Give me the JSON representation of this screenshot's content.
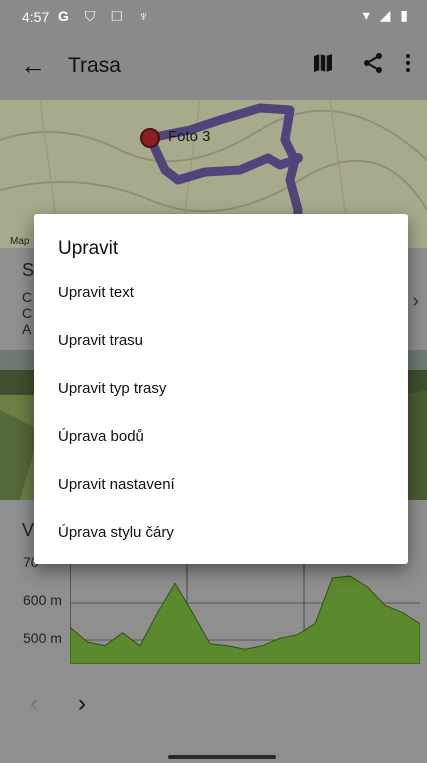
{
  "status_bar": {
    "time": "4:57",
    "icons": [
      "google-g-icon",
      "shield-icon",
      "screenshot-icon",
      "usb-icon"
    ],
    "right_icons": [
      "wifi-icon",
      "signal-icon",
      "battery-icon"
    ]
  },
  "app_bar": {
    "title": "Trasa",
    "back_icon": "arrow-back-icon",
    "actions": [
      "map-icon",
      "share-icon",
      "more-vert-icon"
    ]
  },
  "map": {
    "marker_label": "Foto 3",
    "attribution": "Map"
  },
  "background": {
    "section_letter": "S",
    "line1": "C",
    "line2": "C",
    "line3": "A",
    "chart_section_letter": "V"
  },
  "chart_data": {
    "type": "area",
    "y_ticks": [
      "600 m",
      "500 m"
    ],
    "partial_top_tick": "70",
    "color": "#5b8a2e",
    "x": [
      0,
      5,
      10,
      15,
      20,
      25,
      30,
      35,
      40,
      45,
      50,
      55,
      60,
      65,
      70,
      75,
      80,
      85,
      90,
      95,
      100
    ],
    "values": [
      520,
      480,
      470,
      505,
      470,
      560,
      640,
      560,
      475,
      470,
      460,
      470,
      490,
      500,
      530,
      655,
      660,
      630,
      580,
      560,
      530
    ],
    "ylim": [
      420,
      720
    ]
  },
  "dialog": {
    "title": "Upravit",
    "items": [
      "Upravit text",
      "Upravit trasu",
      "Upravit typ trasy",
      "Úprava bodů",
      "Upravit nastavení",
      "Úprava stylu čáry"
    ]
  },
  "bottom_nav": {
    "prev": "‹",
    "next": "›"
  }
}
